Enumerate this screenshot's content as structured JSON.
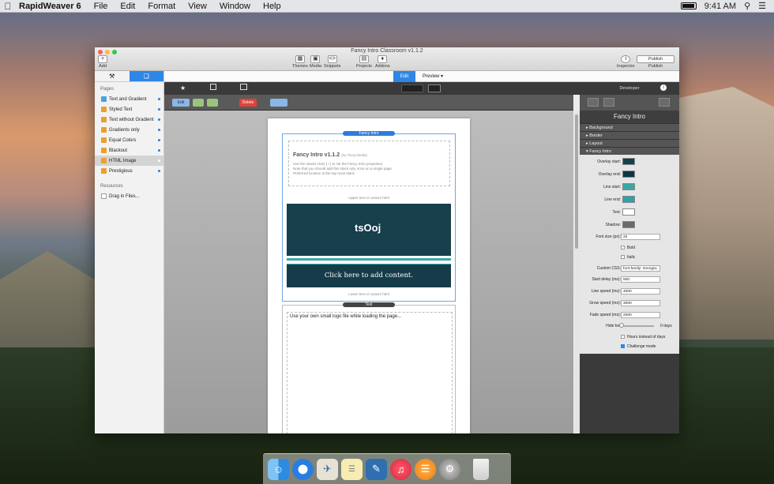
{
  "menubar": {
    "app_name": "RapidWeaver 6",
    "menus": [
      "File",
      "Edit",
      "Format",
      "View",
      "Window",
      "Help"
    ],
    "time": "9:41 AM"
  },
  "window": {
    "title": "Fancy Intro Classroom v1.1.2",
    "toolbar": {
      "add": "Add",
      "themes": "Themes",
      "media": "Media",
      "snippets": "Snippets",
      "projects": "Projects",
      "addons": "Addons",
      "inspector": "Inspector",
      "publish": "Publish",
      "publish_menu": "Publish"
    }
  },
  "sidebar": {
    "pages_header": "Pages",
    "pages": [
      "Text and Gradient",
      "Styled Text",
      "Text without Gradient",
      "Gradients only",
      "Equal Colors",
      "Blackout",
      "HTML Image",
      "Prestigious"
    ],
    "selected": "HTML Image",
    "resources_header": "Resources",
    "resources_item": "Drag in Files..."
  },
  "modes": {
    "edit": "Edit",
    "preview": "Preview"
  },
  "stackbar": {
    "edit": "Edit",
    "delete": "Delete"
  },
  "content": {
    "fancy_pill": "Fancy Intro",
    "stack_title": "Fancy Intro v1.1.2",
    "stack_by": "(by Tsooj Media)",
    "stack_desc1": "Use the stacks HUD ( i ) to set the Fancy Intro properties.",
    "stack_desc2": "Note that you should add this stack only once on a single page.",
    "stack_desc3": "Preferred location is the top most stack.",
    "upper_text": "Upper text or custom html",
    "logo": "tsOoj",
    "cta": "Click here to add content.",
    "lower_text": "Lower text or custom html",
    "text_pill": "Text",
    "text_body": "Use your own small logo file while loading the page..."
  },
  "inspector": {
    "header": "Developer",
    "title": "Fancy Intro",
    "sections": [
      "Background",
      "Border",
      "Layout",
      "Fancy Intro"
    ],
    "colors": [
      {
        "label": "Overlay start:",
        "color": "#163f4e"
      },
      {
        "label": "Overlay end:",
        "color": "#0f3544"
      },
      {
        "label": "Line start:",
        "color": "#3aa7a4"
      },
      {
        "label": "Line end:",
        "color": "#2fa2a6"
      },
      {
        "label": "Text:",
        "color": "#ffffff"
      },
      {
        "label": "Shadow:",
        "color": "#6a6a6a"
      }
    ],
    "font_size_label": "Font size (px):",
    "font_size": "20",
    "bold": "Bold",
    "italic": "Italic",
    "css_label": "Custom CSS:",
    "css": "font-family: Georgia;",
    "start_delay_label": "Start delay (ms):",
    "start_delay": "500",
    "line_speed_label": "Line speed (ms):",
    "line_speed": "4000",
    "grow_speed_label": "Grow speed (ms):",
    "grow_speed": "3000",
    "fade_speed_label": "Fade speed (ms):",
    "fade_speed": "2000",
    "hide_label": "Hide for:",
    "hide_value": "0 days",
    "hours": "Hours instead of days",
    "challenge": "Challenge mode"
  }
}
